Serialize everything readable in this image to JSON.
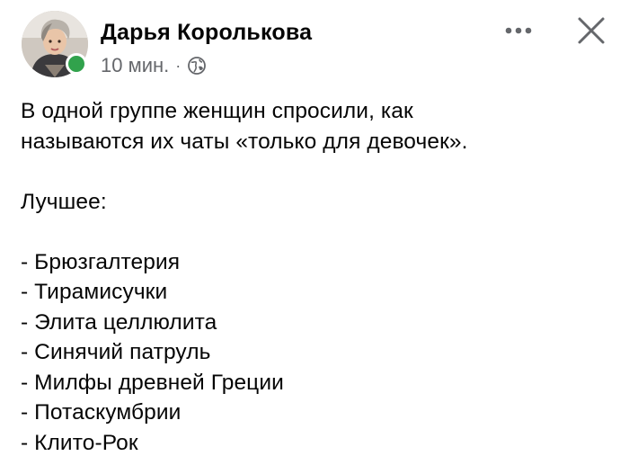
{
  "post": {
    "author": "Дарья Королькова",
    "time": "10 мин.",
    "separator": "·",
    "audience_icon": "globe-icon",
    "online_status_color": "#31a24c",
    "more_icon": "more-dots-icon",
    "close_icon": "close-icon",
    "intro_lines": [
      "В одной группе женщин спросили, как",
      "называются их чаты «только для девочек»."
    ],
    "best_label": "Лучшее:",
    "list_items": [
      "- Брюзгалтерия",
      "- Тирамисучки",
      "- Элита целлюлита",
      "- Синячий патруль",
      "- Милфы древней Греции",
      "- Потаскумбрии",
      "- Клито-Рок"
    ]
  }
}
